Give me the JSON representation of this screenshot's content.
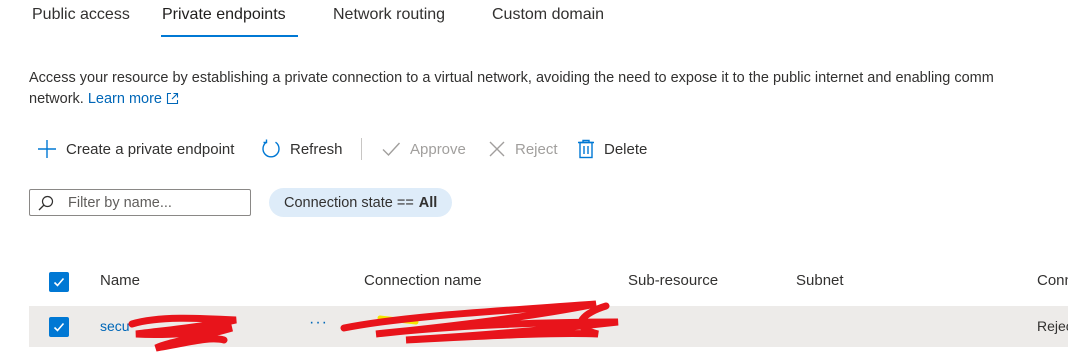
{
  "tabs": [
    {
      "label": "Public access",
      "active": false
    },
    {
      "label": "Private endpoints",
      "active": true
    },
    {
      "label": "Network routing",
      "active": false
    },
    {
      "label": "Custom domain",
      "active": false
    }
  ],
  "description": {
    "text": "Access your resource by establishing a private connection to a virtual network, avoiding the need to expose it to the public internet and enabling comm",
    "text_line2": "network.",
    "learn_more": "Learn more"
  },
  "toolbar": {
    "create": "Create a private endpoint",
    "refresh": "Refresh",
    "approve": "Approve",
    "reject": "Reject",
    "delete": "Delete"
  },
  "filter": {
    "placeholder": "Filter by name..."
  },
  "pill": {
    "label": "Connection state ==",
    "value": "All"
  },
  "table": {
    "columns": [
      "Name",
      "Connection name",
      "Sub-resource",
      "Subnet",
      "Conn"
    ],
    "rows": [
      {
        "name": "secu",
        "connection_name": "",
        "sub_resource": "",
        "subnet": "",
        "state": "Rejec",
        "selected": true
      }
    ]
  },
  "colors": {
    "accent": "#0078d4",
    "link": "#0067b8",
    "pill_bg": "#deecf9",
    "row_selected_bg": "#edebe9",
    "redaction": "#e8141b"
  },
  "icons": [
    "plus-icon",
    "refresh-icon",
    "checkmark-icon",
    "close-icon",
    "trash-icon",
    "search-icon",
    "external-link-icon",
    "checkbox-checked-icon",
    "more-icon"
  ]
}
